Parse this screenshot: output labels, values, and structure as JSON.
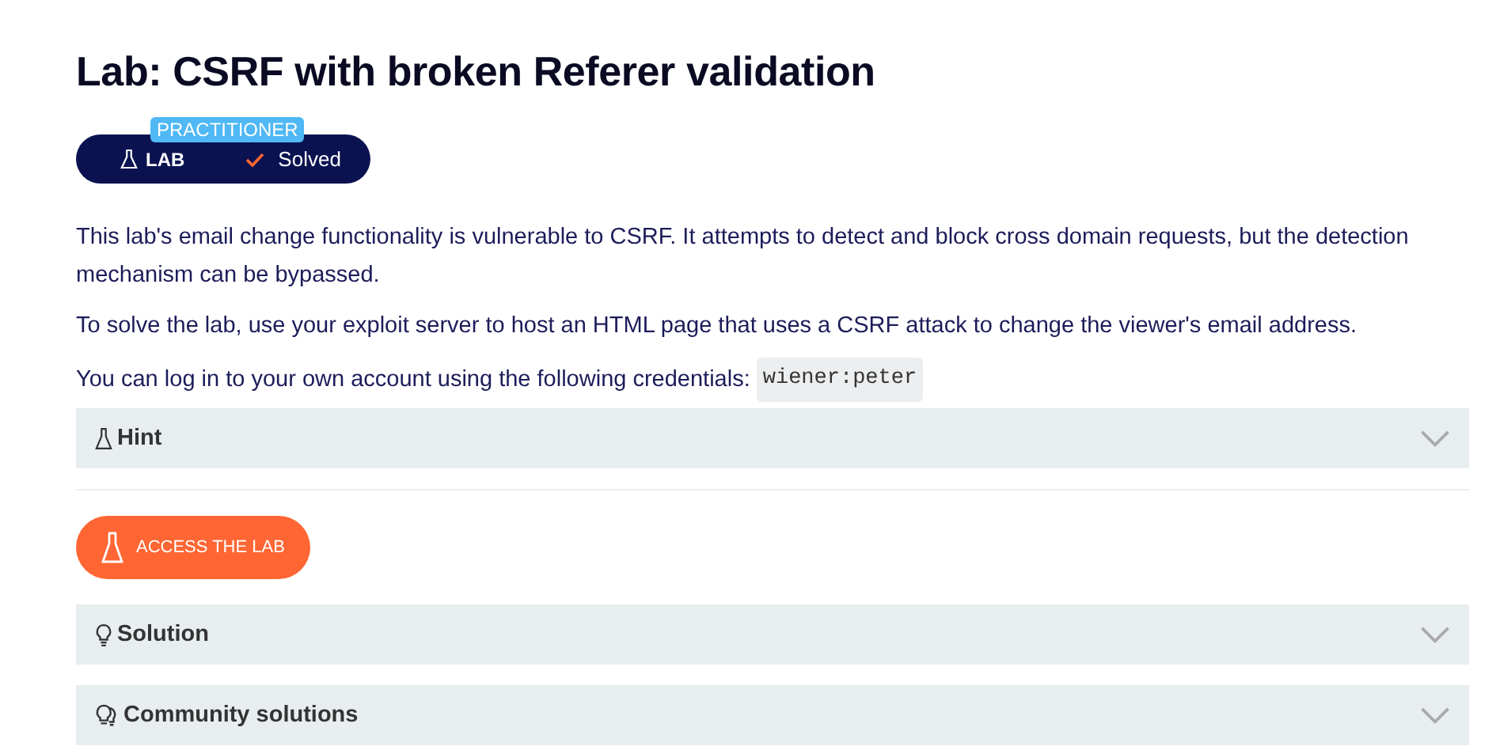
{
  "title": "Lab: CSRF with broken Referer validation",
  "badge": {
    "level_label": "PRACTITIONER",
    "type_label": "LAB",
    "status": "Solved",
    "solved": true
  },
  "paragraphs": [
    "This lab's email change functionality is vulnerable to CSRF. It attempts to detect and block cross domain requests, but the detection mechanism can be bypassed.",
    "To solve the lab, use your exploit server to host an HTML page that uses a CSRF attack to change the viewer's email address."
  ],
  "credentials": {
    "text": "You can log in to your own account using the following credentials:",
    "code": "wiener:peter"
  },
  "sections_before": [
    {
      "label": "Hint",
      "kind": "flask",
      "expanded": false
    }
  ],
  "access_button": "ACCESS THE LAB",
  "sections_after": [
    {
      "label": "Solution",
      "kind": "bulb",
      "expanded": false
    },
    {
      "label": "Community solutions",
      "kind": "bulbs",
      "expanded": false
    }
  ]
}
